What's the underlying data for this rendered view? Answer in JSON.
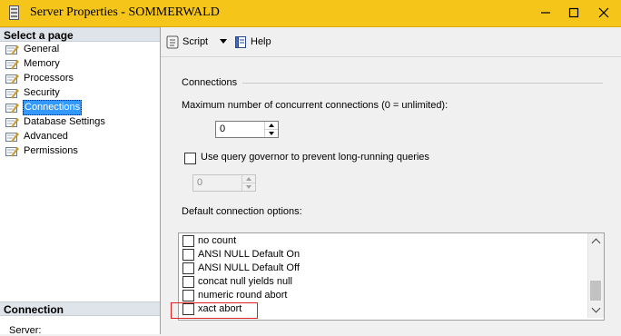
{
  "window": {
    "title": "Server Properties - SOMMERWALD",
    "icons": {
      "app": "server-icon",
      "minimize": "minimize-icon",
      "maximize": "maximize-icon",
      "close": "close-icon"
    }
  },
  "left_pane": {
    "select_page_header": "Select a page",
    "pages": [
      {
        "label": "General",
        "icon": "wrench-page-icon"
      },
      {
        "label": "Memory",
        "icon": "wrench-page-icon"
      },
      {
        "label": "Processors",
        "icon": "wrench-page-icon"
      },
      {
        "label": "Security",
        "icon": "wrench-page-icon"
      },
      {
        "label": "Connections",
        "icon": "wrench-page-icon",
        "selected": true
      },
      {
        "label": "Database Settings",
        "icon": "wrench-page-icon"
      },
      {
        "label": "Advanced",
        "icon": "wrench-page-icon"
      },
      {
        "label": "Permissions",
        "icon": "wrench-page-icon"
      }
    ],
    "connection_header": "Connection",
    "server_label": "Server:"
  },
  "toolbar": {
    "script_label": "Script",
    "help_label": "Help"
  },
  "connections": {
    "group_title": "Connections",
    "max_connections_label": "Maximum number of concurrent connections (0 = unlimited):",
    "max_connections_value": "0",
    "query_governor_label": "Use query governor to prevent long-running queries",
    "query_governor_checked": false,
    "query_governor_value": "0",
    "default_options_label": "Default connection options:",
    "options": [
      {
        "label": "no count",
        "checked": false
      },
      {
        "label": "ANSI NULL Default On",
        "checked": false
      },
      {
        "label": "ANSI NULL Default Off",
        "checked": false
      },
      {
        "label": "concat null yields null",
        "checked": false
      },
      {
        "label": "numeric round abort",
        "checked": false
      },
      {
        "label": "xact abort",
        "checked": false
      }
    ]
  },
  "colors": {
    "title_bar": "#f5c51a",
    "selection": "#3399ff",
    "highlight_box": "#e02020"
  }
}
